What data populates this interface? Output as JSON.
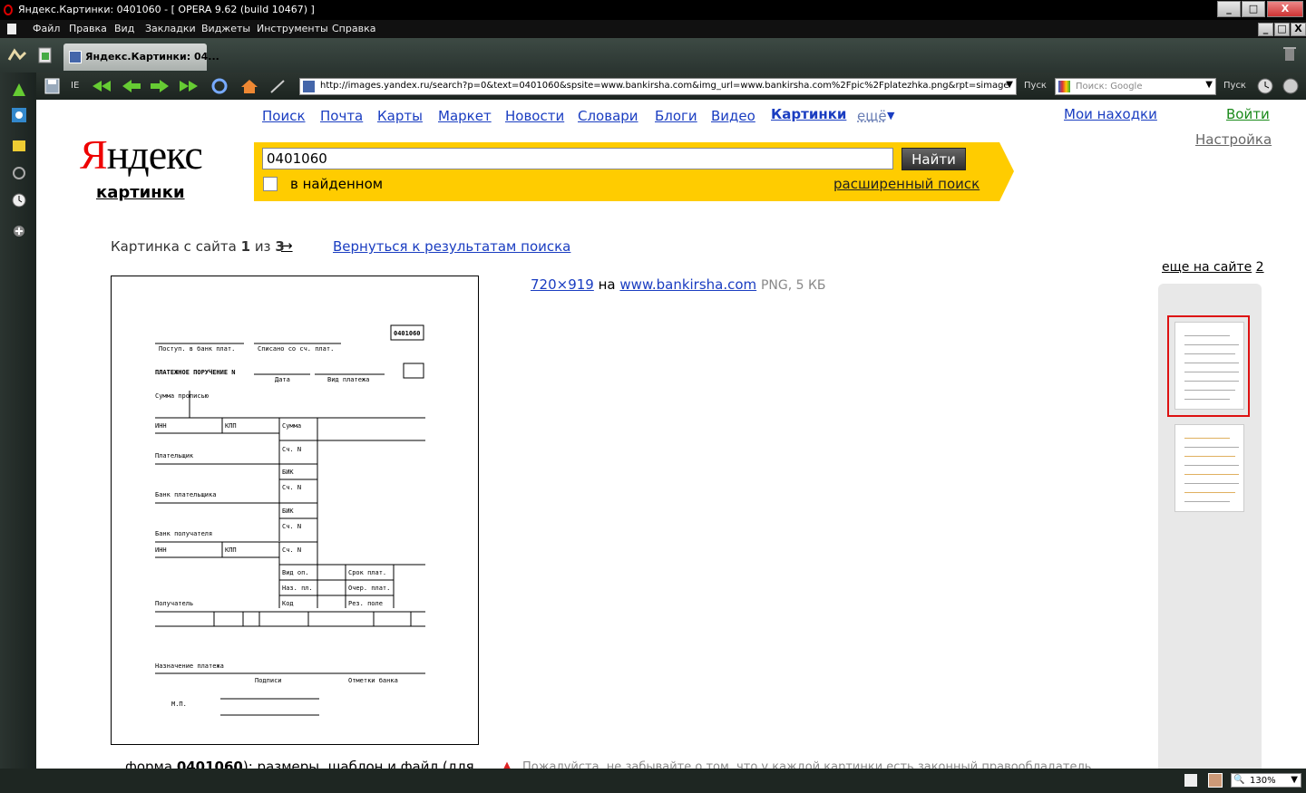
{
  "browser": {
    "title": "Яндекс.Картинки: 0401060 - [ OPERA 9.62 (build 10467) ]",
    "menu": [
      "Файл",
      "Правка",
      "Вид",
      "Закладки",
      "Виджеты",
      "Инструменты",
      "Справка"
    ],
    "tab_label": "Яндекс.Картинки: 04...",
    "ie_label": "IE",
    "address": "http://images.yandex.ru/search?p=0&text=0401060&spsite=www.bankirsha.com&img_url=www.bankirsha.com%2Fpic%2Fplatezhka.png&rpt=simage",
    "go_label": "Пуск",
    "search_placeholder": "Поиск: Google",
    "search_go_label": "Пуск",
    "zoom": "130%",
    "win_min": "_",
    "win_max": "□",
    "win_close": "X"
  },
  "yandex": {
    "nav": [
      "Поиск",
      "Почта",
      "Карты",
      "Маркет",
      "Новости",
      "Словари",
      "Блоги",
      "Видео",
      "Картинки",
      "ещё"
    ],
    "my_finds": "Мои находки",
    "login": "Войти",
    "settings": "Настройка",
    "logo_y": "Я",
    "logo_rest": "ндекс",
    "logo_sub": "картинки",
    "query": "0401060",
    "find_button": "Найти",
    "in_found": "в найденном",
    "advanced": "расширенный поиск",
    "pager_prefix": "Картинка с сайта",
    "pager_current": "1",
    "pager_of": "из",
    "pager_total": "3",
    "pager_arrow": "→",
    "back_link": "Вернуться к результатам поиска",
    "size_link": "720×919",
    "on_word": "на",
    "site_link": "www.bankirsha.com",
    "file_info": "PNG, 5 КБ",
    "more_on_site": "еще на сайте",
    "more_count": "2",
    "caption_start": "форма",
    "caption_bold": "0401060",
    "caption_rest": "): размеры, шаблон и файл (для",
    "warning": "Пожалуйста, не забывайте о том, что у каждой картинки есть законный правообладатель"
  },
  "form": {
    "code": "0401060",
    "received": "Поступ. в банк плат.",
    "debited": "Списано со сч. плат.",
    "title": "ПЛАТЕЖНОЕ ПОРУЧЕНИЕ N",
    "date": "Дата",
    "pay_type": "Вид платежа",
    "sum_words": "Сумма прописью",
    "inn": "ИНН",
    "kpp": "КПП",
    "sum": "Сумма",
    "acc_no": "Сч. N",
    "payer": "Плательщик",
    "bik": "БИК",
    "payer_bank": "Банк плательщика",
    "payee_bank": "Банк получателя",
    "op_type": "Вид оп.",
    "pay_term": "Срок плат.",
    "pay_purpose_code": "Наз. пл.",
    "pay_order": "Очер. плат.",
    "code_label": "Код",
    "reserve": "Рез. поле",
    "payee": "Получатель",
    "purpose": "Назначение платежа",
    "signatures": "Подписи",
    "bank_marks": "Отметки банка",
    "mp": "М.П."
  }
}
